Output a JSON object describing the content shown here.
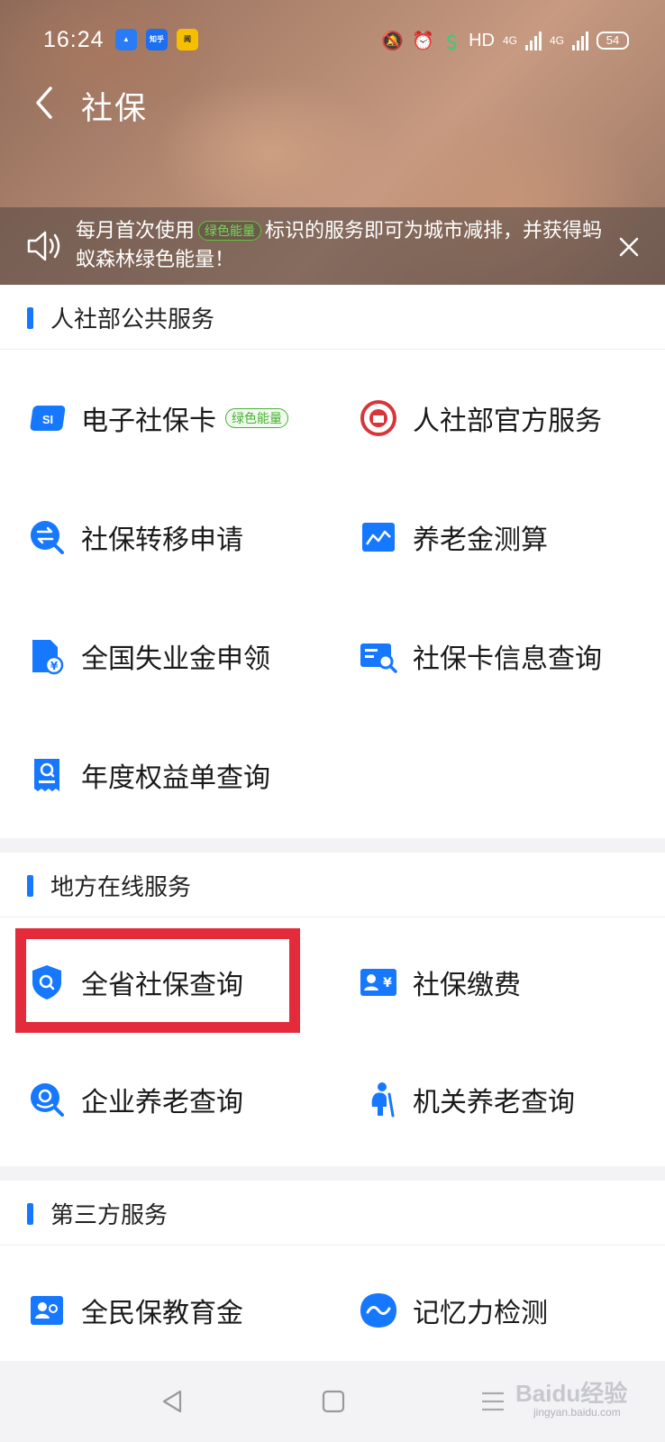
{
  "status_bar": {
    "time": "16:24",
    "app_badges": [
      "知乎",
      "阅"
    ],
    "network": "HD",
    "net_type_1": "4G",
    "net_type_2": "4G",
    "battery": "54"
  },
  "header": {
    "title": "社保"
  },
  "notice": {
    "text_before": "每月首次使用",
    "tag": "绿色能量",
    "text_after": "标识的服务即可为城市减排，并获得蚂蚁森林绿色能量！"
  },
  "sections": [
    {
      "title": "人社部公共服务",
      "items": [
        {
          "label": "电子社保卡",
          "tag": "绿色能量",
          "icon": "social-card-icon"
        },
        {
          "label": "人社部官方服务",
          "icon": "ministry-emblem-icon"
        },
        {
          "label": "社保转移申请",
          "icon": "transfer-icon"
        },
        {
          "label": "养老金测算",
          "icon": "line-chart-icon"
        },
        {
          "label": "全国失业金申领",
          "icon": "unemployment-doc-icon"
        },
        {
          "label": "社保卡信息查询",
          "icon": "card-search-icon"
        },
        {
          "label": "年度权益单查询",
          "icon": "annual-statement-icon"
        }
      ]
    },
    {
      "title": "地方在线服务",
      "items": [
        {
          "label": "全省社保查询",
          "icon": "shield-search-icon"
        },
        {
          "label": "社保缴费",
          "icon": "payment-card-icon"
        },
        {
          "label": "企业养老查询",
          "icon": "enterprise-search-icon"
        },
        {
          "label": "机关养老查询",
          "icon": "elder-person-icon"
        }
      ]
    },
    {
      "title": "第三方服务",
      "items": [
        {
          "label": "全民保教育金",
          "icon": "education-fund-icon"
        },
        {
          "label": "记忆力检测",
          "icon": "memory-test-icon"
        }
      ]
    }
  ],
  "watermark": {
    "text": "Baidu经验",
    "sub": "jingyan.baidu.com"
  },
  "colors": {
    "accent": "#1677ff",
    "green_tag": "#47b035",
    "highlight": "#e42b3b"
  }
}
